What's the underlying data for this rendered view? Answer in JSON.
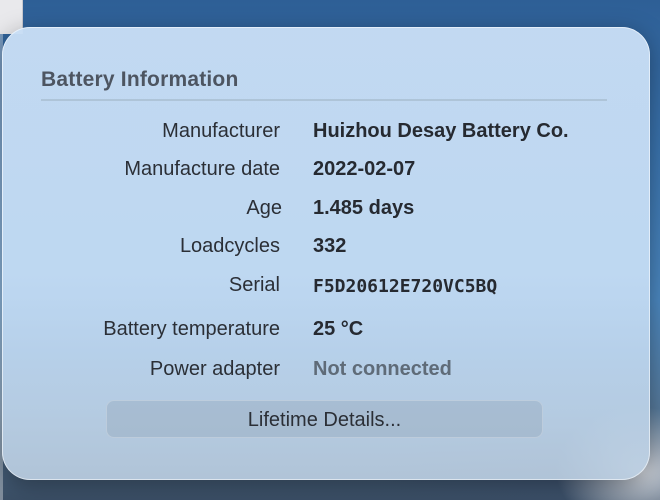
{
  "panel": {
    "title": "Battery Information",
    "rows": [
      {
        "label": "Manufacturer",
        "value": "Huizhou Desay Battery Co."
      },
      {
        "label": "Manufacture date",
        "value": "2022-02-07"
      },
      {
        "label": "Age",
        "value": "1.485 days"
      },
      {
        "label": "Loadcycles",
        "value": "332"
      },
      {
        "label": "Serial",
        "value": "F5D20612E720VC5BQ"
      },
      {
        "label": "Battery temperature",
        "value": "25 °C"
      },
      {
        "label": "Power adapter",
        "value": "Not connected"
      }
    ],
    "button_label": "Lifetime Details..."
  }
}
